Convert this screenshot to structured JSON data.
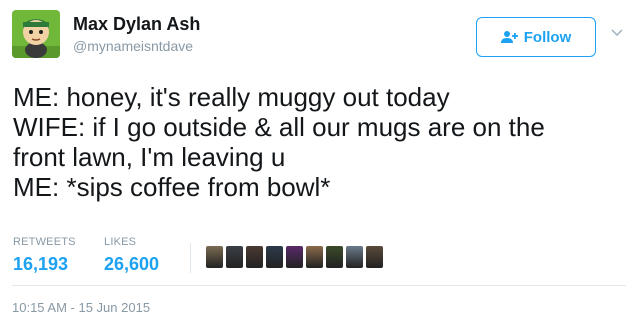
{
  "author": {
    "display_name": "Max Dylan Ash",
    "screen_name": "@mynameisntdave",
    "avatar_icon": "cartoon-character-avatar"
  },
  "follow_button": {
    "label": "Follow",
    "icon": "add-user-icon"
  },
  "tweet": {
    "lines": [
      "ME: honey, it's really muggy out today",
      "WIFE: if I go outside & all our mugs are on the",
      "front lawn, I'm leaving u",
      "ME: *sips coffee from bowl*"
    ]
  },
  "stats": {
    "retweets": {
      "label": "RETWEETS",
      "count": "16,193"
    },
    "likes": {
      "label": "LIKES",
      "count": "26,600"
    }
  },
  "likers": [
    {
      "color": "#7b6b52"
    },
    {
      "color": "#3b3f46"
    },
    {
      "color": "#4a3a32"
    },
    {
      "color": "#2d3a4a"
    },
    {
      "color": "#5a2a6a"
    },
    {
      "color": "#8a6a4a"
    },
    {
      "color": "#3a4a2a"
    },
    {
      "color": "#6a7a8a"
    },
    {
      "color": "#5a4a3a"
    }
  ],
  "timestamp": "10:15 AM - 15 Jun 2015",
  "colors": {
    "accent": "#1da1f2",
    "muted": "#8899a6",
    "text": "#14171a"
  }
}
